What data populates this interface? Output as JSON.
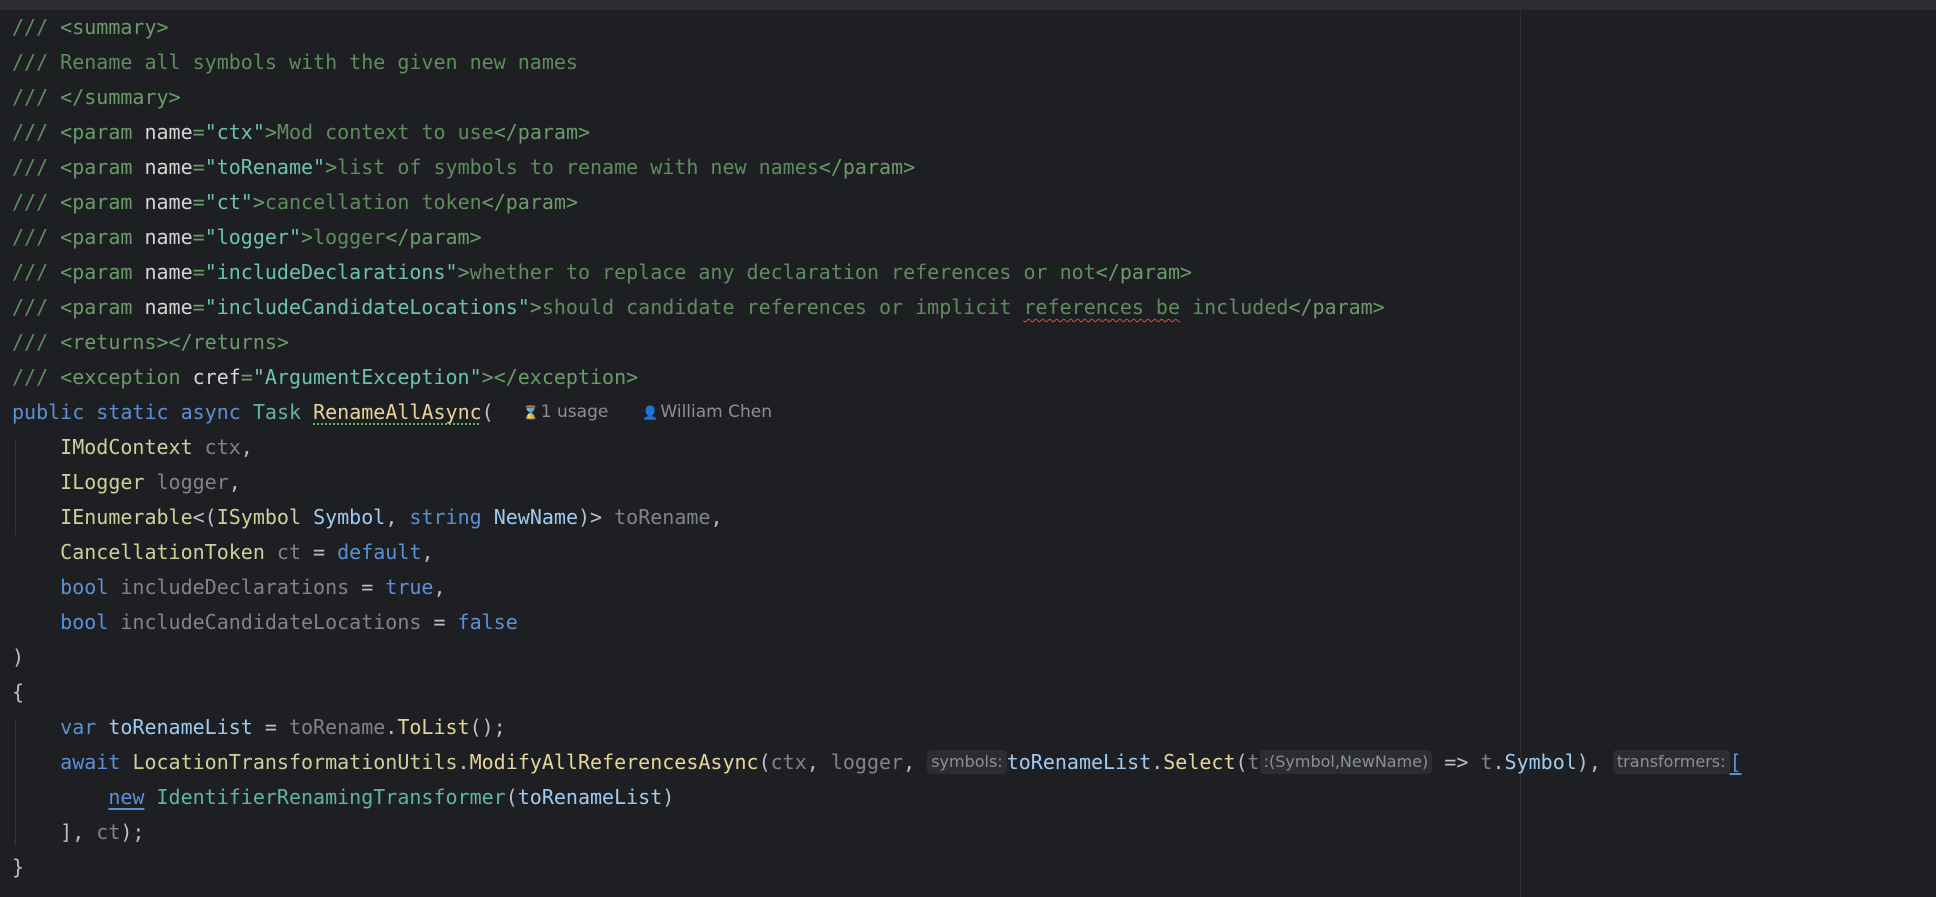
{
  "editor": {
    "doc_lines": [
      {
        "prefix": "/// ",
        "tag": "<summary>"
      },
      {
        "prefix": "/// ",
        "text": "Rename all symbols with the given new names"
      },
      {
        "prefix": "/// ",
        "tag": "</summary>"
      }
    ],
    "params": [
      {
        "open": "<param ",
        "attr": "name",
        "eq": "=",
        "val": "\"ctx\"",
        "close": ">",
        "text": "Mod context to use",
        "end": "</param>"
      },
      {
        "open": "<param ",
        "attr": "name",
        "eq": "=",
        "val": "\"toRename\"",
        "close": ">",
        "text": "list of symbols to rename with new names",
        "end": "</param>"
      },
      {
        "open": "<param ",
        "attr": "name",
        "eq": "=",
        "val": "\"ct\"",
        "close": ">",
        "text": "cancellation token",
        "end": "</param>"
      },
      {
        "open": "<param ",
        "attr": "name",
        "eq": "=",
        "val": "\"logger\"",
        "close": ">",
        "text": "logger",
        "end": "</param>"
      },
      {
        "open": "<param ",
        "attr": "name",
        "eq": "=",
        "val": "\"includeDeclarations\"",
        "close": ">",
        "text": "whether to replace any declaration references or not",
        "end": "</param>"
      },
      {
        "open": "<param ",
        "attr": "name",
        "eq": "=",
        "val": "\"includeCandidateLocations\"",
        "close": ">",
        "text_before": "should candidate references or implicit ",
        "squiggle": "references be",
        "text_after": " included",
        "end": "</param>"
      }
    ],
    "returns": "<returns></returns>",
    "exception": {
      "open": "<exception ",
      "attr": "cref",
      "eq": "=",
      "val": "\"ArgumentException\"",
      "close": "></exception>"
    },
    "signature": {
      "kw1": "public",
      "kw2": "static",
      "kw3": "async",
      "ret": "Task",
      "name": "RenameAllAsync",
      "paren": "(",
      "usage_icon": "hourglass-icon",
      "usage": "1 usage",
      "author_icon": "person-icon",
      "author": "William Chen"
    },
    "args": {
      "a1_type": "IModContext",
      "a1_name": "ctx",
      "a1_punct": ",",
      "a2_type": "ILogger",
      "a2_name": "logger",
      "a2_punct": ",",
      "a3_type": "IEnumerable",
      "a3_open": "<(",
      "a3_t1": "ISymbol",
      "a3_f1": "Symbol",
      "a3_c": ", ",
      "a3_t2": "string",
      "a3_f2": "NewName",
      "a3_close": ")>",
      "a3_name": "toRename",
      "a3_punct": ",",
      "a4_type": "CancellationToken",
      "a4_name": "ct",
      "a4_eq": " = ",
      "a4_val": "default",
      "a4_punct": ",",
      "a5_type": "bool",
      "a5_name": "includeDeclarations",
      "a5_eq": " = ",
      "a5_val": "true",
      "a5_punct": ",",
      "a6_type": "bool",
      "a6_name": "includeCandidateLocations",
      "a6_eq": " = ",
      "a6_val": "false"
    },
    "close_paren": ")",
    "open_brace": "{",
    "body": {
      "l1_var": "var",
      "l1_name": "toRenameList",
      "l1_eq": " = ",
      "l1_src": "toRename",
      "l1_dot": ".",
      "l1_method": "ToList",
      "l1_end": "();",
      "l2_await": "await",
      "l2_class": "LocationTransformationUtils",
      "l2_dot": ".",
      "l2_method": "ModifyAllReferencesAsync",
      "l2_paren": "(",
      "l2_a1": "ctx",
      "l2_c1": ", ",
      "l2_a2": "logger",
      "l2_c2": ", ",
      "l2_hint1": "symbols:",
      "l2_list": "toRenameList",
      "l2_dot2": ".",
      "l2_select": "Select",
      "l2_p2": "(",
      "l2_t": "t",
      "l2_hint2": ":(Symbol,NewName)",
      "l2_arrow": " => ",
      "l2_t2": "t",
      "l2_dot3": ".",
      "l2_sym": "Symbol",
      "l2_close": "), ",
      "l2_hint3": "transformers:",
      "l2_bracket": "[",
      "l3_new": "new",
      "l3_class": "IdentifierRenamingTransformer",
      "l3_p": "(",
      "l3_arg": "toRenameList",
      "l3_c": ")",
      "l4_close": "], ",
      "l4_ct": "ct",
      "l4_end": ");"
    },
    "close_brace": "}"
  }
}
